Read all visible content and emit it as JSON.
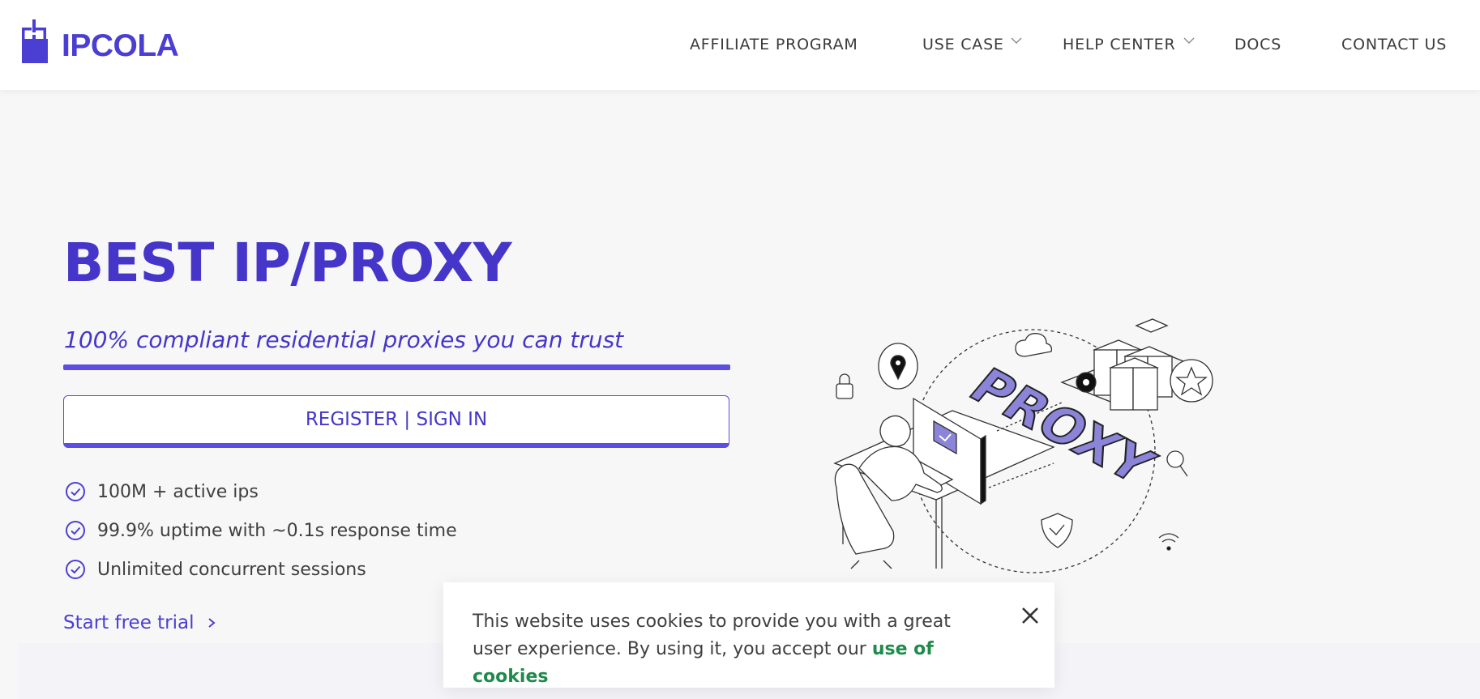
{
  "brand": {
    "name": "IPCOLA",
    "color": "#4b3fd3"
  },
  "nav": {
    "affiliate": "AFFILIATE PROGRAM",
    "use_case": "USE CASE",
    "help_center": "HELP CENTER",
    "docs": "DOCS",
    "contact": "CONTACT US"
  },
  "hero": {
    "title": "BEST IP/PROXY",
    "subtitle": "100% compliant residential proxies you can trust",
    "cta": "REGISTER | SIGN IN",
    "features": [
      "100M + active ips",
      "99.9% uptime with ~0.1s response time",
      "Unlimited concurrent sessions"
    ],
    "trial": "Start free trial"
  },
  "illustration": {
    "word": "PROXY"
  },
  "cookie": {
    "text": "This website uses cookies to provide you with a great user experience. By using it, you accept our",
    "link": "use of cookies"
  },
  "colors": {
    "accent": "#4536c9",
    "accent_light": "#5b4ee0",
    "link_green": "#1f8a4c",
    "illustration_fill": "#8b84d9"
  },
  "icons": {
    "check": "check-circle-icon",
    "caret": "chevron-down-icon",
    "arrow": "chevron-right-icon",
    "close": "close-icon"
  }
}
